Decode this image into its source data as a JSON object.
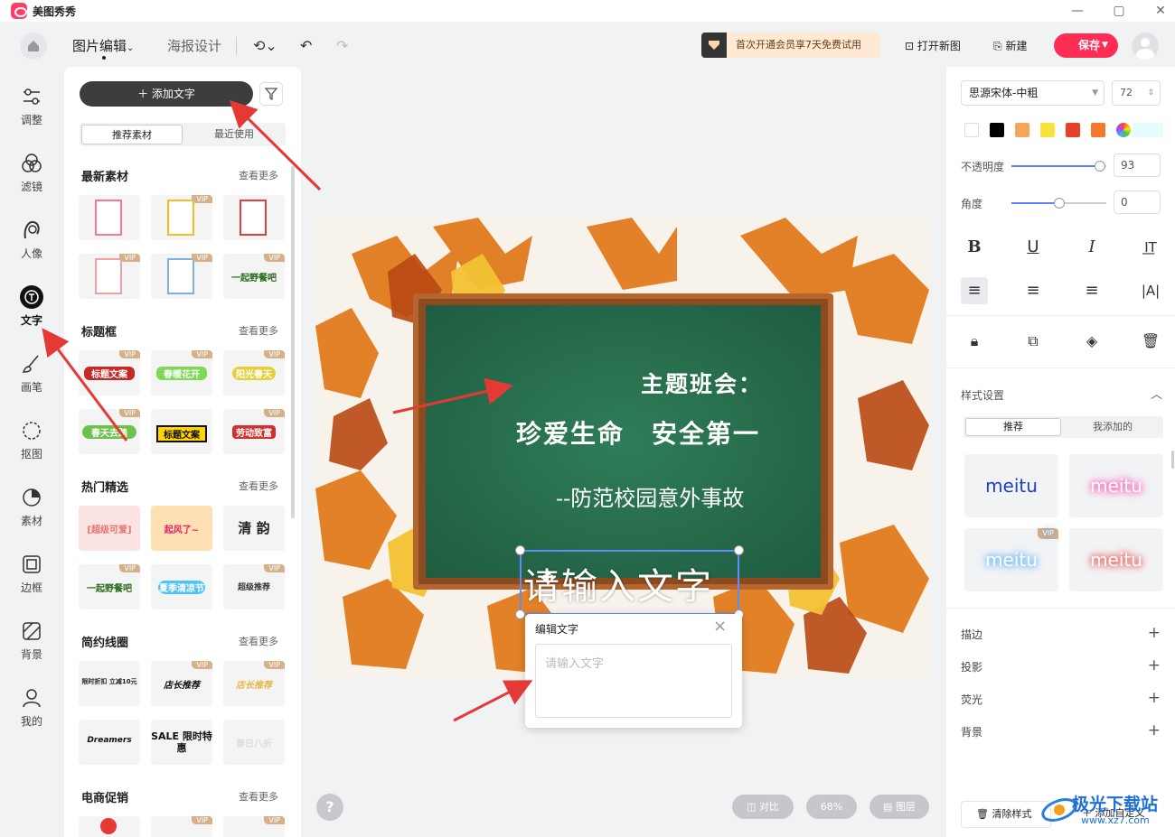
{
  "window": {
    "title": "美图秀秀"
  },
  "header": {
    "tab_edit": "图片编辑",
    "tab_poster": "海报设计",
    "vip_banner": "首次开通会员享7天免费试用",
    "open_new": "打开新图",
    "new_file": "新建",
    "save": "保存"
  },
  "nav": [
    "调整",
    "滤镜",
    "人像",
    "文字",
    "画笔",
    "抠图",
    "素材",
    "边框",
    "背景",
    "我的"
  ],
  "nav_active": "文字",
  "left_panel": {
    "add_text": "添加文字",
    "tab_recommended": "推荐素材",
    "tab_recent": "最近使用",
    "more_label": "查看更多",
    "vip_label": "VIP",
    "sections": [
      {
        "title": "最新素材",
        "thumbs": [
          "",
          "",
          "",
          "",
          "",
          "一起野餐吧"
        ]
      },
      {
        "title": "标题框",
        "thumbs": [
          "标题文案",
          "春暖花开",
          "阳光春天",
          "春天去踏",
          "标题文案",
          "劳动致富"
        ]
      },
      {
        "title": "热门精选",
        "thumbs": [
          "[超级可爱]",
          "起风了~",
          "清 韵",
          "一起野餐吧",
          "夏季清凉节",
          "超级推荐"
        ]
      },
      {
        "title": "简约线圈",
        "thumbs": [
          "限时折扣 立减10元",
          "店长推荐",
          "店长推荐",
          "Dreamers",
          "SALE 限时特惠",
          "春日八折"
        ]
      },
      {
        "title": "电商促销",
        "thumbs": [
          "",
          "",
          ""
        ]
      }
    ]
  },
  "canvas": {
    "board_line1": "主题班会：",
    "board_line2": "珍爱生命　安全第一",
    "board_line3": "--防范校园意外事故",
    "text_placeholder": "请输入文字",
    "zoom": "68%",
    "compare": "对比",
    "layers": "图层",
    "help": "?"
  },
  "edit_popup": {
    "title": "编辑文字",
    "placeholder": "请输入文字",
    "value": ""
  },
  "right_panel": {
    "font": "思源宋体-中粗",
    "size": "72",
    "colors": [
      "#ffffff",
      "#000000",
      "#f5a65b",
      "#f7e43a",
      "#e8402d",
      "#f07a2a"
    ],
    "opacity_label": "不透明度",
    "opacity_value": "93",
    "angle_label": "角度",
    "angle_value": "0",
    "style_settings": "样式设置",
    "style_tab_recommended": "推荐",
    "style_tab_mine": "我添加的",
    "style_sample": "meitu",
    "vip_label": "VIP",
    "stroke": "描边",
    "shadow": "投影",
    "glow": "荧光",
    "background": "背景",
    "clear_style": "清除样式",
    "add_custom": "添加自定义"
  },
  "watermark": {
    "line1": "极光下载站",
    "line2": "www.xz7.com"
  }
}
